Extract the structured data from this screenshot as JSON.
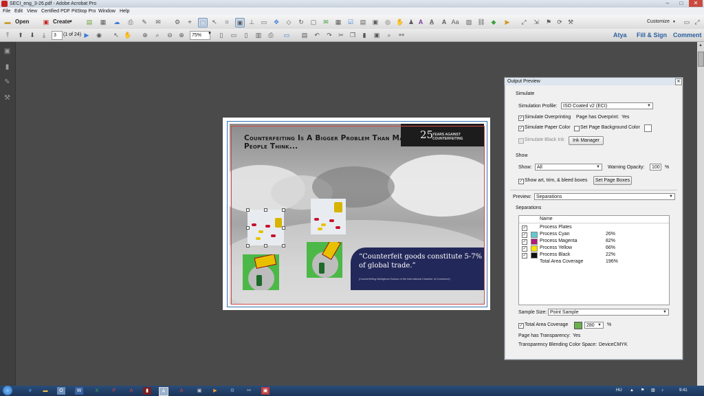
{
  "window": {
    "title": "SECI_eng_3-26.pdf - Adobe Acrobat Pro",
    "controls": [
      "–",
      "□",
      "✕"
    ]
  },
  "menu": [
    "File",
    "Edit",
    "View",
    "Certified PDF",
    "PitStop Pro",
    "Window",
    "Help"
  ],
  "toolbar": {
    "open_label": "Open",
    "create_label": "Create",
    "customize_label": "Customize"
  },
  "nav": {
    "page_current": "3",
    "page_count": "(1 of 24)",
    "zoom": "75%"
  },
  "right_links": {
    "user": "Atya",
    "fill_sign": "Fill & Sign",
    "comment": "Comment"
  },
  "document": {
    "headline": "Counterfeiting is a bigger problem than many people think...",
    "badge_number": "25",
    "badge_text": "YEARS AGAINST COUNTERFEITING",
    "quote": "“Counterfeit goods constitute 5-7% of global trade.”",
    "quote_source": "(Counterfeiting Intelligence Bureau of the International Chamber of Commerce)"
  },
  "output_preview": {
    "title": "Output Preview",
    "simulate_header": "Simulate",
    "simulation_profile_label": "Simulation Profile:",
    "simulation_profile_value": "ISO Coated v2 (ECI)",
    "simulate_overprinting": "Simulate Overprinting",
    "page_has_overprint_label": "Page has Overprint:",
    "page_has_overprint_value": "Yes",
    "simulate_paper_color": "Simulate Paper Color",
    "set_page_background": "Set Page Background Color",
    "simulate_black_ink": "Simulate Black Ink",
    "ink_manager": "Ink Manager",
    "show_header": "Show",
    "show_label": "Show:",
    "show_value": "All",
    "warning_opacity_label": "Warning Opacity:",
    "warning_opacity_value": "100",
    "percent": "%",
    "show_boxes": "Show art, trim, & bleed boxes",
    "set_page_boxes": "Set Page Boxes",
    "preview_label": "Preview:",
    "preview_value": "Separations",
    "separations_header": "Separations",
    "name_col": "Name",
    "separations": [
      {
        "name": "Process Plates",
        "value": "",
        "color": ""
      },
      {
        "name": "Process Cyan",
        "value": "26%",
        "color": "#5fc8d0"
      },
      {
        "name": "Process Magenta",
        "value": "82%",
        "color": "#b0197e"
      },
      {
        "name": "Process Yellow",
        "value": "66%",
        "color": "#f4e400"
      },
      {
        "name": "Process Black",
        "value": "22%",
        "color": "#111111"
      },
      {
        "name": "Total Area Coverage",
        "value": "196%",
        "color": ""
      }
    ],
    "sample_size_label": "Sample Size:",
    "sample_size_value": "Point Sample",
    "total_area_coverage": "Total Area Coverage",
    "total_area_value": "280",
    "page_has_transparency_label": "Page has Transparency:",
    "page_has_transparency_value": "Yes",
    "blending_label": "Transparency Blending Color Space:",
    "blending_value": "DeviceCMYK"
  },
  "tray": {
    "lang": "HU",
    "time": "9:41"
  }
}
